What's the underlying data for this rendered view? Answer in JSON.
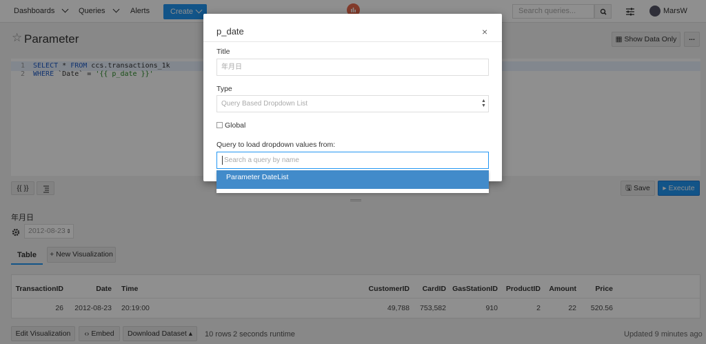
{
  "navbar": {
    "dashboards": "Dashboards",
    "queries": "Queries",
    "alerts": "Alerts",
    "create": "Create",
    "search_placeholder": "Search queries...",
    "user": "MarsW"
  },
  "page": {
    "title": "Parameter",
    "show_data_only": "Show Data Only",
    "more": "..."
  },
  "editor": {
    "lines": [
      {
        "num": "1",
        "keyword1": "SELECT",
        "mid1": " * ",
        "keyword2": "FROM",
        "rest": " ccs.transactions_1k"
      },
      {
        "num": "2",
        "keyword1": "WHERE",
        "mid1": " `Date` = ",
        "str": "'{{ p_date }}'"
      }
    ]
  },
  "toolbar": {
    "braces": "{{ }}",
    "save": "Save",
    "execute": "Execute"
  },
  "parameter": {
    "label": "年月日",
    "value": "2012-08-23"
  },
  "tabs": {
    "table": "Table",
    "new_visualization": "+ New Visualization"
  },
  "table": {
    "headers": [
      "TransactionID",
      "Date",
      "Time",
      "CustomerID",
      "CardID",
      "GasStationID",
      "ProductID",
      "Amount",
      "Price"
    ],
    "row": [
      "26",
      "2012-08-23",
      "20:19:00",
      "49,788",
      "753,582",
      "910",
      "2",
      "22",
      "520.56"
    ]
  },
  "footer": {
    "edit_visualization": "Edit Visualization",
    "embed": "Embed",
    "download": "Download Dataset",
    "rows": "10 rows",
    "runtime": "2 seconds runtime",
    "updated": "Updated 9 minutes ago"
  },
  "modal": {
    "title": "p_date",
    "close": "×",
    "title_label": "Title",
    "title_placeholder": "年月日",
    "type_label": "Type",
    "type_value": "Query Based Dropdown List",
    "global_label": "Global",
    "query_label": "Query to load dropdown values from:",
    "query_placeholder": "Search a query by name",
    "dropdown_option": "Parameter DateList"
  },
  "colors": {
    "accent": "#2196f3",
    "dropdown_highlight": "#428bca",
    "logo": "#e86a4e"
  }
}
